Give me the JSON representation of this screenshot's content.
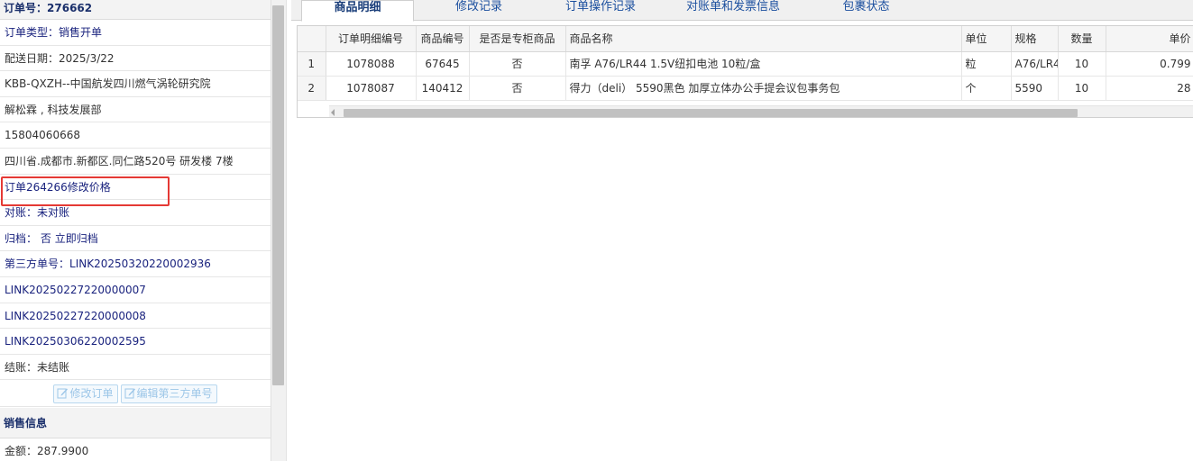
{
  "order": {
    "number_label": "订单号：",
    "number": "276662",
    "type_label": "订单类型：",
    "type": "销售开单",
    "delivery_date_label": "配送日期：",
    "delivery_date": "2025/3/22",
    "customer": "KBB-QXZH--中国航发四川燃气涡轮研究院",
    "contact": "解松霖 , 科技发展部",
    "phone": "15804060668",
    "address": "四川省.成都市.新都区.同仁路520号 研发楼 7楼",
    "price_change_link": "订单264266修改价格",
    "reconcile_label": "对账：",
    "reconcile_status": "未对账",
    "archive_label": "归档：",
    "archive_status": "否",
    "archive_action": "立即归档",
    "third_party_label": "第三方单号：",
    "third_party_numbers": [
      "LINK20250320220002936",
      "LINK20250227220000007",
      "LINK20250227220000008",
      "LINK20250306220002595"
    ],
    "settle_label": "结账：",
    "settle_status": "未结账",
    "edit_order_button": "修改订单",
    "edit_third_party_button": "编辑第三方单号"
  },
  "sales_info": {
    "title": "销售信息",
    "amount_label": "金额：",
    "amount": "287.9900"
  },
  "tabs": [
    {
      "label": "商品明细",
      "active": true
    },
    {
      "label": "修改记录",
      "active": false
    },
    {
      "label": "订单操作记录",
      "active": false
    },
    {
      "label": "对账单和发票信息",
      "active": false
    },
    {
      "label": "包裹状态",
      "active": false
    }
  ],
  "grid": {
    "columns": [
      "订单明细编号",
      "商品编号",
      "是否是专柜商品",
      "商品名称",
      "单位",
      "规格",
      "数量",
      "单价"
    ],
    "rows": [
      {
        "rownum": "1",
        "detail_id": "1078088",
        "product_id": "67645",
        "is_counter": "否",
        "name": "南孚 A76/LR44 1.5V纽扣电池 10粒/盒",
        "unit": "粒",
        "spec": "A76/LR4",
        "qty": "10",
        "price": "0.799"
      },
      {
        "rownum": "2",
        "detail_id": "1078087",
        "product_id": "140412",
        "is_counter": "否",
        "name": "得力（deli） 5590黑色 加厚立体办公手提会议包事务包",
        "unit": "个",
        "spec": "5590",
        "qty": "10",
        "price": "28"
      }
    ]
  },
  "colors": {
    "label_blue": "#1a237e",
    "link_blue": "#1a3ea5",
    "highlight_red": "#e53935",
    "header_bg": "#f3f3f3"
  }
}
